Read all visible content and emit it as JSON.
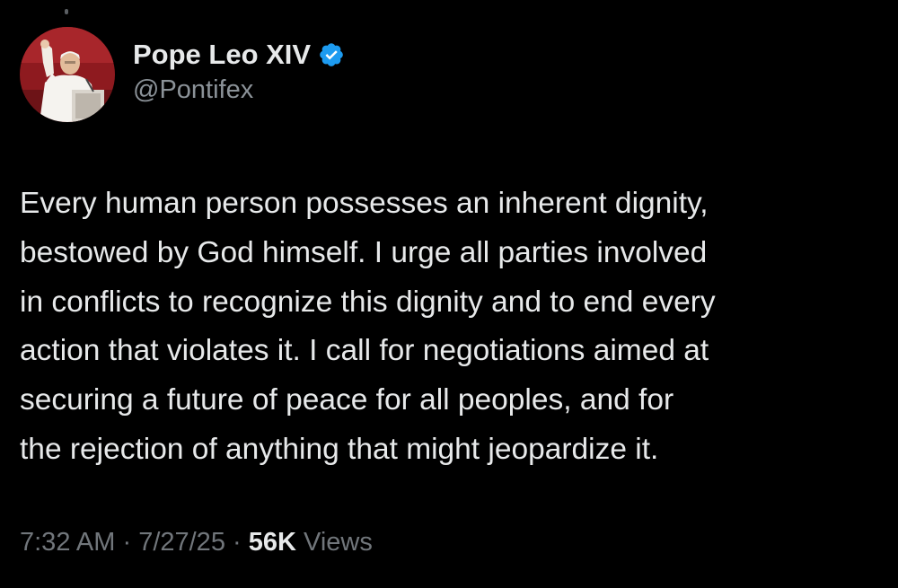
{
  "author": {
    "display_name": "Pope Leo XIV",
    "handle": "@Pontifex",
    "verified": true,
    "verified_badge_color": "#1d9bf0",
    "avatar_icon": "pope-waving-avatar"
  },
  "tweet": {
    "text": "Every human person possesses an inherent dignity,\nbestowed by God himself. I urge all parties involved\nin conflicts to recognize this dignity and to end every\naction that violates it. I call for negotiations aimed at\nsecuring a future of peace for all peoples, and for\nthe rejection of anything that might jeopardize it."
  },
  "meta": {
    "time": "7:32 AM",
    "separator": " · ",
    "date": "7/27/25",
    "views_count": "56K",
    "views_label": " Views"
  },
  "colors": {
    "background": "#000000",
    "primary_text": "#e7e9ea",
    "secondary_text": "#71767b",
    "accent": "#1d9bf0"
  }
}
